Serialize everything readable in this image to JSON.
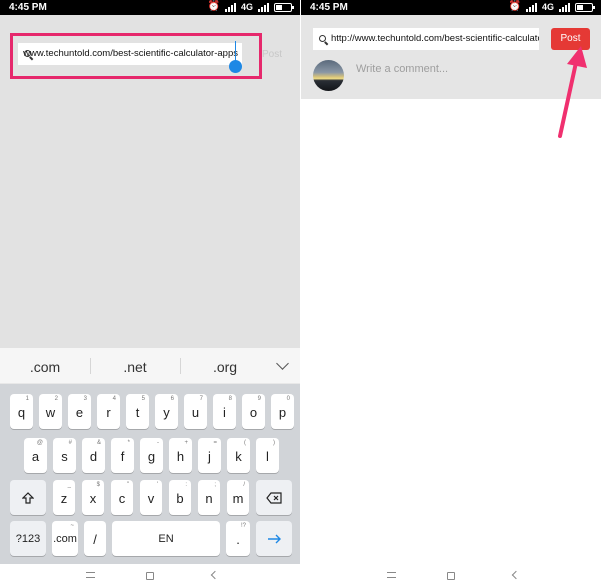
{
  "status_bar": {
    "time": "4:45 PM",
    "network": "4G"
  },
  "left": {
    "url_value": "www.techuntold.com/best-scientific-calculator-apps",
    "post_label": "Post",
    "suggestions": [
      ".com",
      ".net",
      ".org"
    ],
    "keyboard": {
      "row1": [
        [
          "q",
          "1"
        ],
        [
          "w",
          "2"
        ],
        [
          "e",
          "3"
        ],
        [
          "r",
          "4"
        ],
        [
          "t",
          "5"
        ],
        [
          "y",
          "6"
        ],
        [
          "u",
          "7"
        ],
        [
          "i",
          "8"
        ],
        [
          "o",
          "9"
        ],
        [
          "p",
          "0"
        ]
      ],
      "row2": [
        [
          "a",
          "@"
        ],
        [
          "s",
          "#"
        ],
        [
          "d",
          "&"
        ],
        [
          "f",
          "*"
        ],
        [
          "g",
          "-"
        ],
        [
          "h",
          "+"
        ],
        [
          "j",
          "="
        ],
        [
          "k",
          "("
        ],
        [
          "l",
          ")"
        ]
      ],
      "row3": [
        [
          "z",
          "_"
        ],
        [
          "x",
          "$"
        ],
        [
          "c",
          "\""
        ],
        [
          "v",
          "'"
        ],
        [
          "b",
          ":"
        ],
        [
          "n",
          ";"
        ],
        [
          "m",
          "/"
        ]
      ],
      "symbols_key": "?123",
      "com_key": ".com",
      "slash_key": "/",
      "space_key": "EN",
      "period_key": ".",
      "period_hint": "!?",
      "com_hint": "~"
    }
  },
  "right": {
    "url_value": "http://www.techuntold.com/best-scientific-calculator-apps",
    "post_label": "Post",
    "comment_placeholder": "Write a comment..."
  },
  "colors": {
    "highlight": "#e6286c",
    "post_button": "#e53935",
    "cursor": "#1e88e5"
  }
}
